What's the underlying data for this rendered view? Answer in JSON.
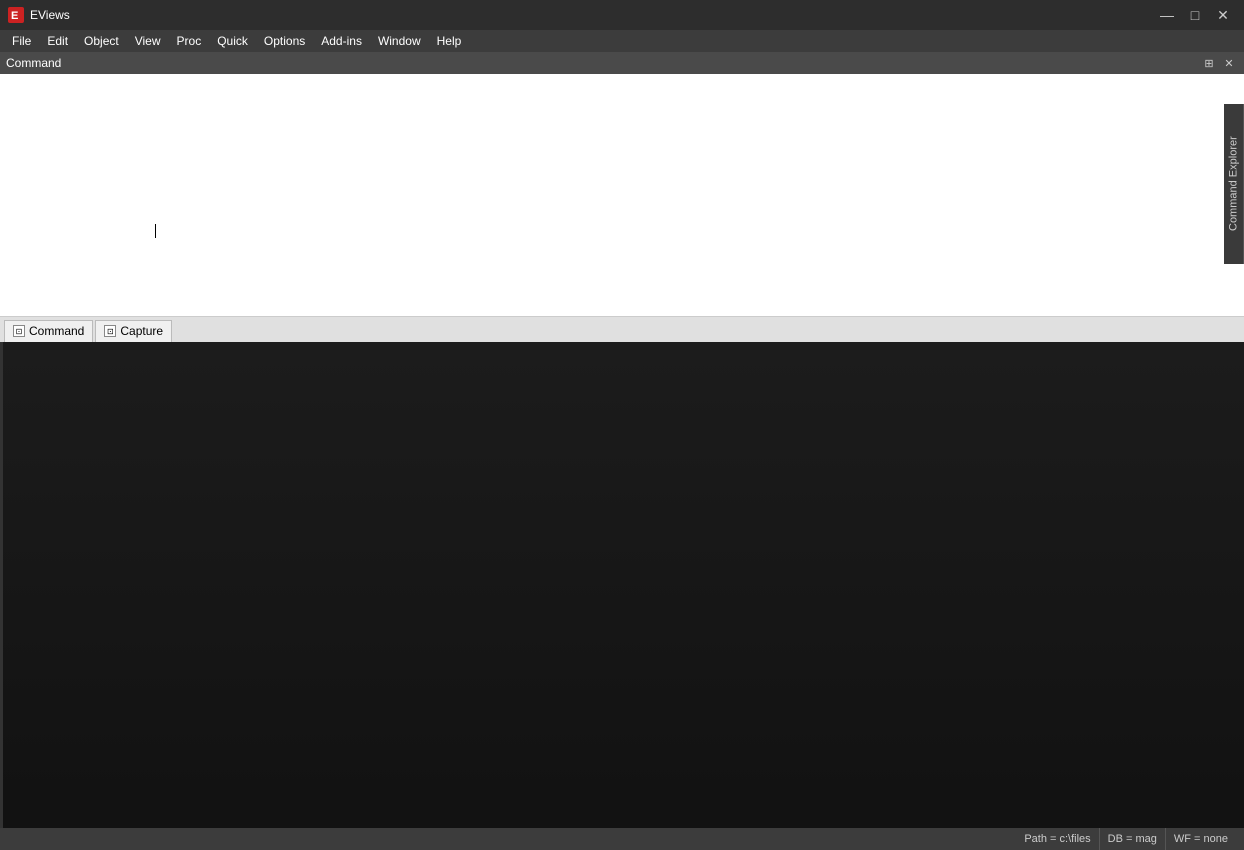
{
  "titlebar": {
    "app_name": "EViews",
    "icon": "E"
  },
  "window_controls": {
    "minimize": "—",
    "maximize": "□",
    "close": "✕"
  },
  "menu": {
    "items": [
      "File",
      "Edit",
      "Object",
      "View",
      "Proc",
      "Quick",
      "Options",
      "Add-ins",
      "Window",
      "Help"
    ]
  },
  "command_panel": {
    "title": "Command",
    "pin_label": "📌",
    "close_label": "✕"
  },
  "tabs": [
    {
      "label": "Command"
    },
    {
      "label": "Capture"
    }
  ],
  "command_explorer": {
    "label": "Command Explorer"
  },
  "status_bar": {
    "path": "Path = c:\\files",
    "db": "DB = mag",
    "wf": "WF = none"
  }
}
